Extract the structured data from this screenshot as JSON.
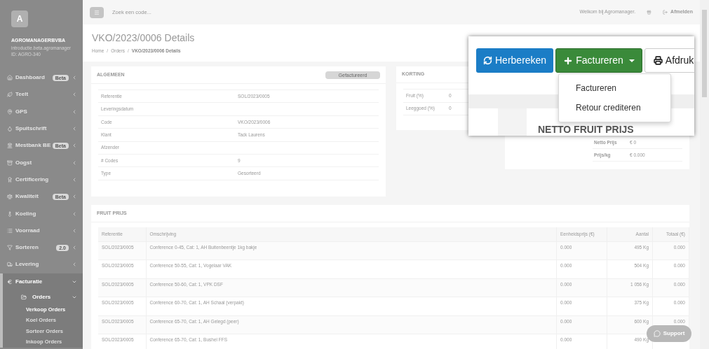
{
  "topbar": {
    "search_placeholder": "Zoek een code...",
    "welcome": "Welkom bij Agromanager.",
    "logout": "Afmelden"
  },
  "sidebar": {
    "avatar": "A",
    "company": "AGROMANAGERBVBA",
    "subtitle": "introductie.beta.agromanager",
    "account_id": "ID: AGRO-340",
    "items": [
      {
        "label": "Dashboard",
        "badge": "Beta",
        "expanded": false,
        "selected": false
      },
      {
        "label": "Teelt",
        "expanded": false,
        "selected": false
      },
      {
        "label": "GPS",
        "expanded": false,
        "selected": false
      },
      {
        "label": "Spuitschrift",
        "expanded": false,
        "selected": false
      },
      {
        "label": "Mestbank BE",
        "badge": "Beta",
        "expanded": false,
        "selected": false
      },
      {
        "label": "Oogst",
        "expanded": false,
        "selected": false
      },
      {
        "label": "Certificering",
        "expanded": false,
        "selected": false
      },
      {
        "label": "Kwaliteit",
        "badge": "Beta",
        "expanded": false,
        "selected": false
      },
      {
        "label": "Koeling",
        "expanded": false,
        "selected": false
      },
      {
        "label": "Voorraad",
        "expanded": false,
        "selected": false
      },
      {
        "label": "Sorteren",
        "badge": "2.0",
        "expanded": false,
        "selected": false
      },
      {
        "label": "Levering",
        "expanded": false,
        "selected": false
      },
      {
        "label": "Facturatie",
        "expanded": true,
        "selected": true,
        "children": [
          {
            "label": "Orders",
            "expanded": true,
            "children": [
              {
                "label": "Verkoop Orders",
                "selected": true
              },
              {
                "label": "Koel Orders",
                "selected": false
              },
              {
                "label": "Sorteer Orders",
                "selected": false
              },
              {
                "label": "Inkoop Orders",
                "selected": false
              }
            ]
          }
        ]
      }
    ]
  },
  "page": {
    "title": "VKO/2023/0006 Details",
    "breadcrumb_separator": "/",
    "breadcrumbs": [
      "Home",
      "Orders",
      "VKO/2023/0006 Details"
    ]
  },
  "algemeen": {
    "title": "ALGEMEEN",
    "status": "Gefactureerd",
    "rows": [
      {
        "label": "Referentie",
        "value": "SOL/2023/0005"
      },
      {
        "label": "Leveringsdatum"
      },
      {
        "label": "Code",
        "value": "VKO/2023/0006"
      },
      {
        "label": "Klant",
        "value": "Tack Laurens"
      },
      {
        "label": "Afzender"
      },
      {
        "label": "# Codes",
        "value": "9"
      },
      {
        "label": "Type",
        "value": "Gesorteerd"
      }
    ]
  },
  "korting": {
    "title": "KORTING",
    "rows": [
      {
        "label": "Fruit (%)",
        "value": "0"
      },
      {
        "label": "Leeggoed (%)",
        "value": "0"
      }
    ]
  },
  "netto": {
    "title": "NETTO FRUIT PRIJS",
    "rows": [
      {
        "label": "Netto Prijs",
        "value": "€ 0"
      },
      {
        "label": "Prijs/kg",
        "value": "€ 0.000"
      }
    ]
  },
  "actions": {
    "buttons": [
      {
        "kind": "recalc",
        "label": "Herbereken"
      },
      {
        "kind": "invoice",
        "label": "Factureren"
      },
      {
        "kind": "print",
        "label": "Afdruk"
      }
    ],
    "menu": [
      "Factureren",
      "Retour crediteren"
    ]
  },
  "fruit_prijs": {
    "title": "FRUIT PRIJS",
    "columns": [
      "Referentie",
      "Omschrijving",
      "Eenheidsprijs (€)",
      "Aantal",
      "Totaal (€)"
    ],
    "rows": [
      [
        "SOL/2023/0005",
        "Conference 0-45, Cat: 1, AH Buitenbeentje 1kg bakje",
        "0.000",
        "495 Kg",
        "0.000"
      ],
      [
        "SOL/2023/0005",
        "Conference 50-55, Cat: 1, Vogelaar VAK",
        "0.000",
        "504 Kg",
        "0.000"
      ],
      [
        "SOL/2023/0005",
        "Conference 50-60, Cat: 1, VPK DSF",
        "0.000",
        "1 056 Kg",
        "0.000"
      ],
      [
        "SOL/2023/0005",
        "Conference 60-70, Cat: 1, AH Schaal (verpakt)",
        "0.000",
        "375 Kg",
        "0.000"
      ],
      [
        "SOL/2023/0005",
        "Conference 65-70, Cat: 1, AH Gelegd (peer)",
        "0.000",
        "600 Kg",
        "0.000"
      ],
      [
        "SOL/2023/0005",
        "Conference 65-70, Cat: 1, Bushel FFS",
        "0.000",
        "490 Kg"
      ]
    ]
  },
  "support": "Support"
}
